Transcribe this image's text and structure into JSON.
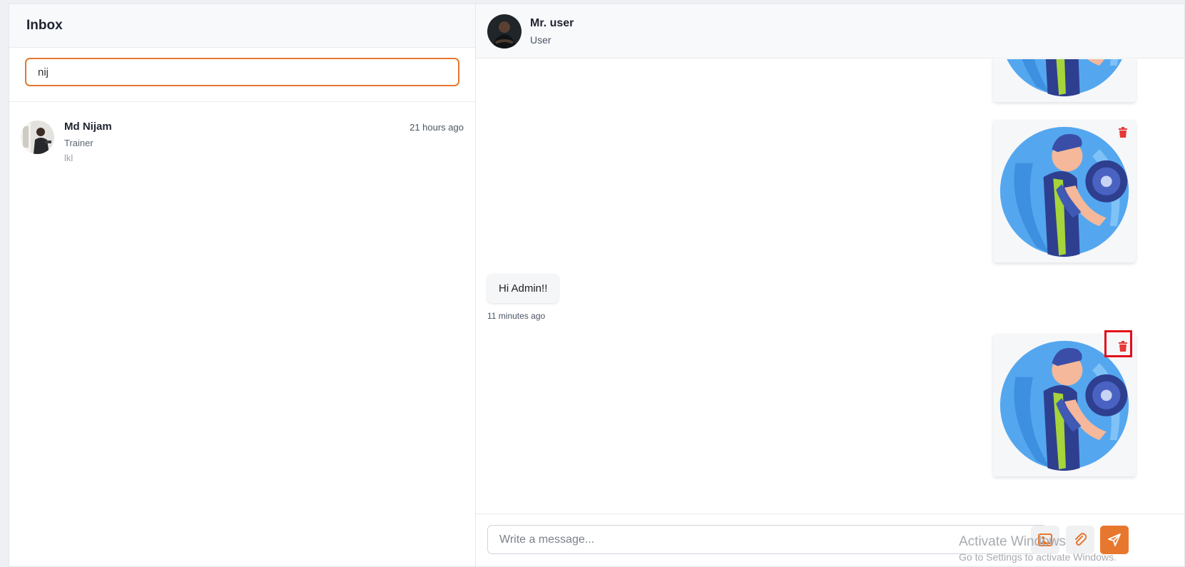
{
  "inbox": {
    "title": "Inbox",
    "search_value": "nij",
    "contacts": [
      {
        "name": "Md Nijam",
        "role": "Trainer",
        "last_message": "lkl",
        "time": "21 hours ago"
      }
    ]
  },
  "chat": {
    "header": {
      "name": "Mr. user",
      "role": "User"
    },
    "messages": [
      {
        "type": "image",
        "sender": "me",
        "icon": "fitness-dumbbell-illustration"
      },
      {
        "type": "image",
        "sender": "me",
        "icon": "fitness-dumbbell-illustration"
      },
      {
        "type": "text",
        "sender": "other",
        "text": "Hi Admin!!",
        "time": "11 minutes ago"
      },
      {
        "type": "image",
        "sender": "me",
        "icon": "fitness-dumbbell-illustration"
      }
    ],
    "composer": {
      "placeholder": "Write a message...",
      "buttons": [
        "image-icon",
        "paperclip-icon",
        "send-icon"
      ]
    }
  },
  "watermark": {
    "title": "Activate Windows",
    "subtitle": "Go to Settings to activate Windows."
  },
  "colors": {
    "accent": "#e8772e",
    "highlight_box": "#e10f1a",
    "trash": "#e53935",
    "image_bg": "#5aa8ee"
  }
}
